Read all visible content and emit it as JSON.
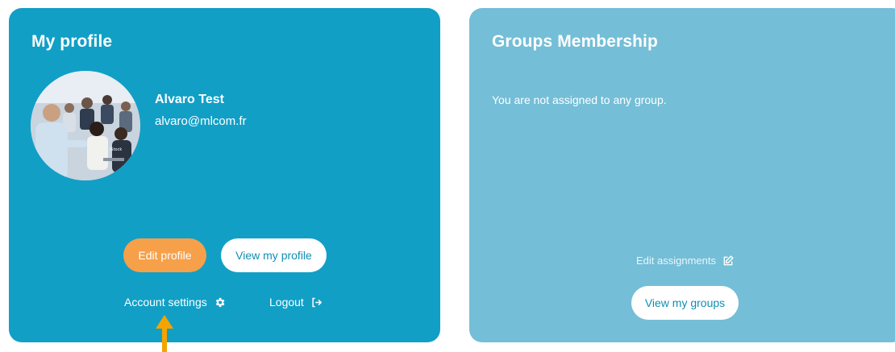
{
  "profile": {
    "title": "My profile",
    "user_name": "Alvaro Test",
    "email": "alvaro@mlcom.fr",
    "avatar_watermark": "iStock",
    "edit_profile_label": "Edit profile",
    "view_profile_label": "View my profile",
    "account_settings_label": "Account settings",
    "account_settings_icon": "gear-icon",
    "logout_label": "Logout",
    "logout_icon": "sign-out-icon"
  },
  "groups": {
    "title": "Groups Membership",
    "empty_message": "You are not assigned to any group.",
    "edit_assignments_label": "Edit assignments",
    "edit_assignments_icon": "edit-icon",
    "view_groups_label": "View my groups"
  },
  "colors": {
    "profile_card_bg": "#119fc6",
    "groups_card_bg": "#74bed7",
    "edit_button_bg": "#f6a04a",
    "button_text": "#0f8fb4",
    "annotation_arrow": "#f5a300"
  }
}
